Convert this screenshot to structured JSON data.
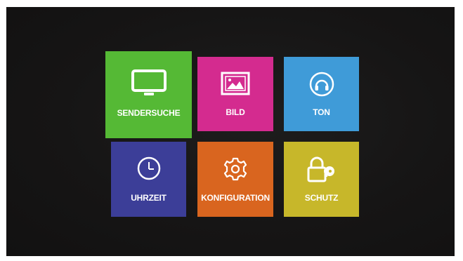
{
  "menu": {
    "tiles": [
      {
        "id": "sendersuche",
        "label": "SENDERSUCHE",
        "icon": "tv-icon",
        "color": "#55b935",
        "selected": true
      },
      {
        "id": "bild",
        "label": "BILD",
        "icon": "picture-icon",
        "color": "#d42b8f"
      },
      {
        "id": "ton",
        "label": "TON",
        "icon": "headphones-icon",
        "color": "#3f9bd8"
      },
      {
        "id": "uhrzeit",
        "label": "UHRZEIT",
        "icon": "clock-icon",
        "color": "#3c3e98"
      },
      {
        "id": "konfiguration",
        "label": "KONFIGURATION",
        "icon": "gear-icon",
        "color": "#d9651f"
      },
      {
        "id": "schutz",
        "label": "SCHUTZ",
        "icon": "lock-key-icon",
        "color": "#c7b72a"
      }
    ]
  }
}
